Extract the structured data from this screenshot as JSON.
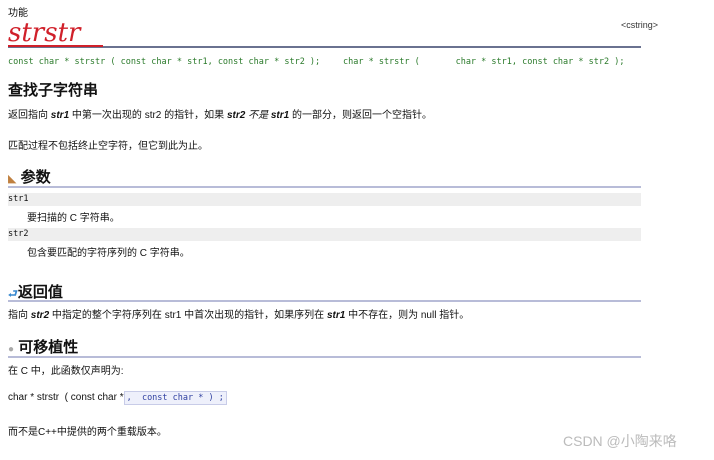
{
  "header": {
    "label": "功能",
    "title": "strstr",
    "tag": "<cstring>"
  },
  "prototypes": {
    "p1": "const char * strstr ( const char * str1, const char * str2 );",
    "p2": "char * strstr (       char * str1, const char * str2 );"
  },
  "main": {
    "title": "查找子字符串",
    "desc_parts": [
      "返回指向 ",
      "str1",
      " 中第一次出现的 str2 的指针，如果 ",
      "str2",
      " 不是 ",
      "str1",
      " 的一部分，则返回一个空指针。"
    ],
    "note": "匹配过程不包括终止空字符，但它到此为止。"
  },
  "params": {
    "title": "参数",
    "items": [
      {
        "name": "str1",
        "desc": "要扫描的 C 字符串。"
      },
      {
        "name": "str2",
        "desc": "包含要匹配的字符序列的 C 字符串。"
      }
    ]
  },
  "return": {
    "title": "返回值",
    "parts": [
      "指向 ",
      "str2",
      " 中指定的整个字符序列在 str1 中首次出现的指针，如果序列在 ",
      "str1",
      " 中不存在，则为 null 指针。"
    ]
  },
  "portability": {
    "title": "可移植性",
    "intro": "在 C 中，此函数仅声明为:",
    "decl_a": "char * strstr  ( const char *",
    "decl_b": ",  const char * ) ;",
    "footer": "而不是C++中提供的两个重载版本。"
  },
  "watermark": "CSDN @小陶来咯"
}
